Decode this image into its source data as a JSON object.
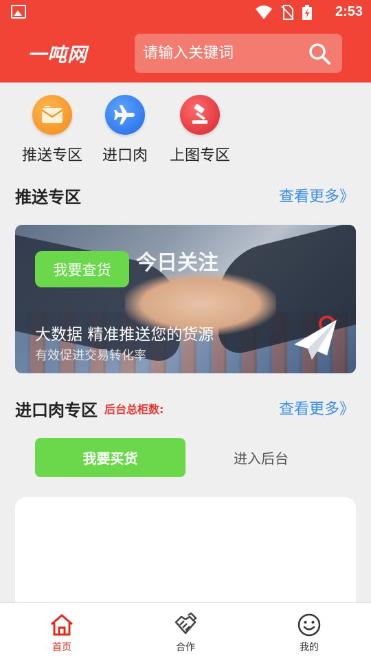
{
  "status_bar": {
    "time": "2:53"
  },
  "header": {
    "logo": "一吨网",
    "search_placeholder": "请输入关键词"
  },
  "quick_links": [
    {
      "label": "推送专区",
      "icon": "envelope-icon",
      "color": "#f39a2e"
    },
    {
      "label": "进口肉",
      "icon": "airplane-icon",
      "color": "#2f7ff0"
    },
    {
      "label": "上图专区",
      "icon": "gavel-icon",
      "color": "#e8373b"
    }
  ],
  "push_section": {
    "title": "推送专区",
    "more": "查看更多》"
  },
  "banner": {
    "overlay_text": "今日关注",
    "button": "我要查货",
    "title": "大数据 精准推送您的货源",
    "subtitle": "有效促进交易转化率"
  },
  "import_section": {
    "title": "进口肉专区",
    "note": "后台总柜数:",
    "more": "查看更多》"
  },
  "tabs": {
    "buy": "我要买货",
    "backend": "进入后台"
  },
  "bottom_nav": [
    {
      "label": "首页",
      "icon": "home-icon",
      "active": true
    },
    {
      "label": "合作",
      "icon": "handshake-icon",
      "active": false
    },
    {
      "label": "我的",
      "icon": "smiley-icon",
      "active": false
    }
  ],
  "colors": {
    "brand_red": "#f14336",
    "accent_green": "#6bd84c",
    "link_blue": "#3a8fe8"
  }
}
